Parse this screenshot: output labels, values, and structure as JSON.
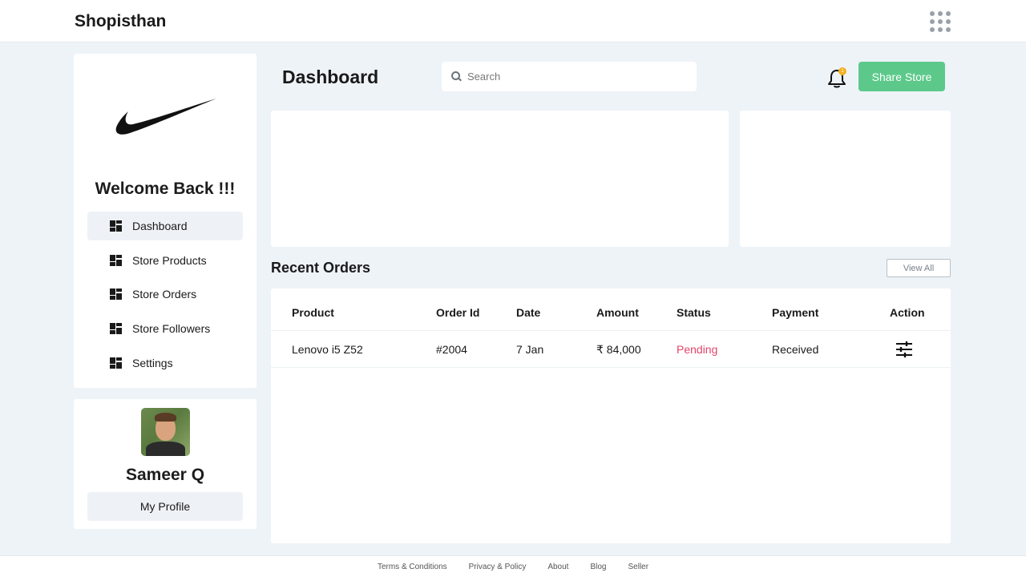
{
  "app": {
    "brand": "Shopisthan"
  },
  "sidebar": {
    "welcome": "Welcome Back !!!",
    "items": [
      {
        "label": "Dashboard",
        "active": true
      },
      {
        "label": "Store Products"
      },
      {
        "label": "Store Orders"
      },
      {
        "label": "Store Followers"
      },
      {
        "label": "Settings"
      }
    ]
  },
  "profile": {
    "name": "Sameer Q",
    "button": "My Profile"
  },
  "header": {
    "title": "Dashboard",
    "search_placeholder": "Search",
    "notification_count": "1",
    "share_label": "Share Store"
  },
  "orders": {
    "title": "Recent Orders",
    "view_all": "View All",
    "columns": [
      "Product",
      "Order Id",
      "Date",
      "Amount",
      "Status",
      "Payment",
      "Action"
    ],
    "rows": [
      {
        "product": "Lenovo i5 Z52",
        "order_id": "#2004",
        "date": "7 Jan",
        "amount": "₹ 84,000",
        "status": "Pending",
        "payment": "Received"
      }
    ]
  },
  "footer": {
    "links": [
      "Terms & Conditions",
      "Privacy & Policy",
      "About",
      "Blog",
      "Seller"
    ]
  },
  "colors": {
    "accent": "#5cc98a",
    "pending": "#e2456a",
    "badge": "#f4b21f",
    "background": "#eef3f8"
  }
}
